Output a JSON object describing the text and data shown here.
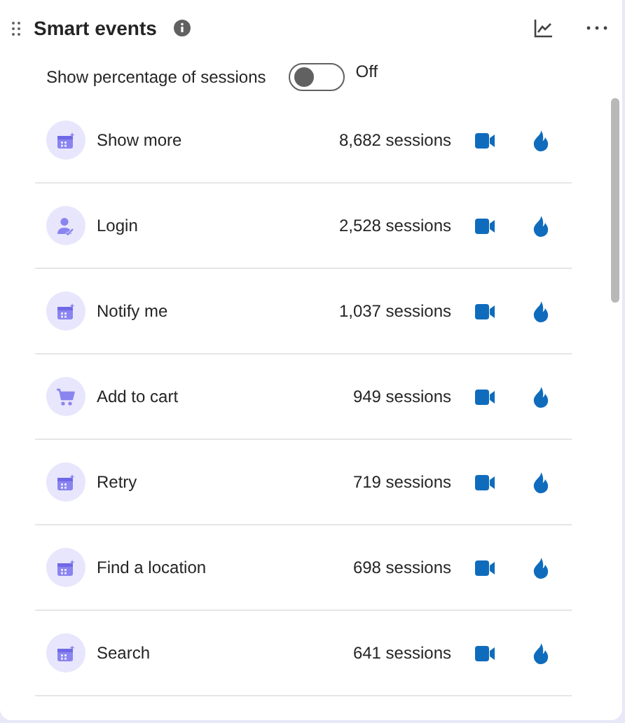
{
  "header": {
    "title": "Smart events"
  },
  "toggle": {
    "label": "Show percentage of sessions",
    "on": false,
    "state_text": "Off"
  },
  "events": [
    {
      "name": "Show more",
      "kind": "event",
      "sessions": "8,682 sessions"
    },
    {
      "name": "Login",
      "kind": "user",
      "sessions": "2,528 sessions"
    },
    {
      "name": "Notify me",
      "kind": "event",
      "sessions": "1,037 sessions"
    },
    {
      "name": "Add to cart",
      "kind": "cart",
      "sessions": "949 sessions"
    },
    {
      "name": "Retry",
      "kind": "event",
      "sessions": "719 sessions"
    },
    {
      "name": "Find a location",
      "kind": "event",
      "sessions": "698 sessions"
    },
    {
      "name": "Search",
      "kind": "event",
      "sessions": "641 sessions"
    }
  ]
}
